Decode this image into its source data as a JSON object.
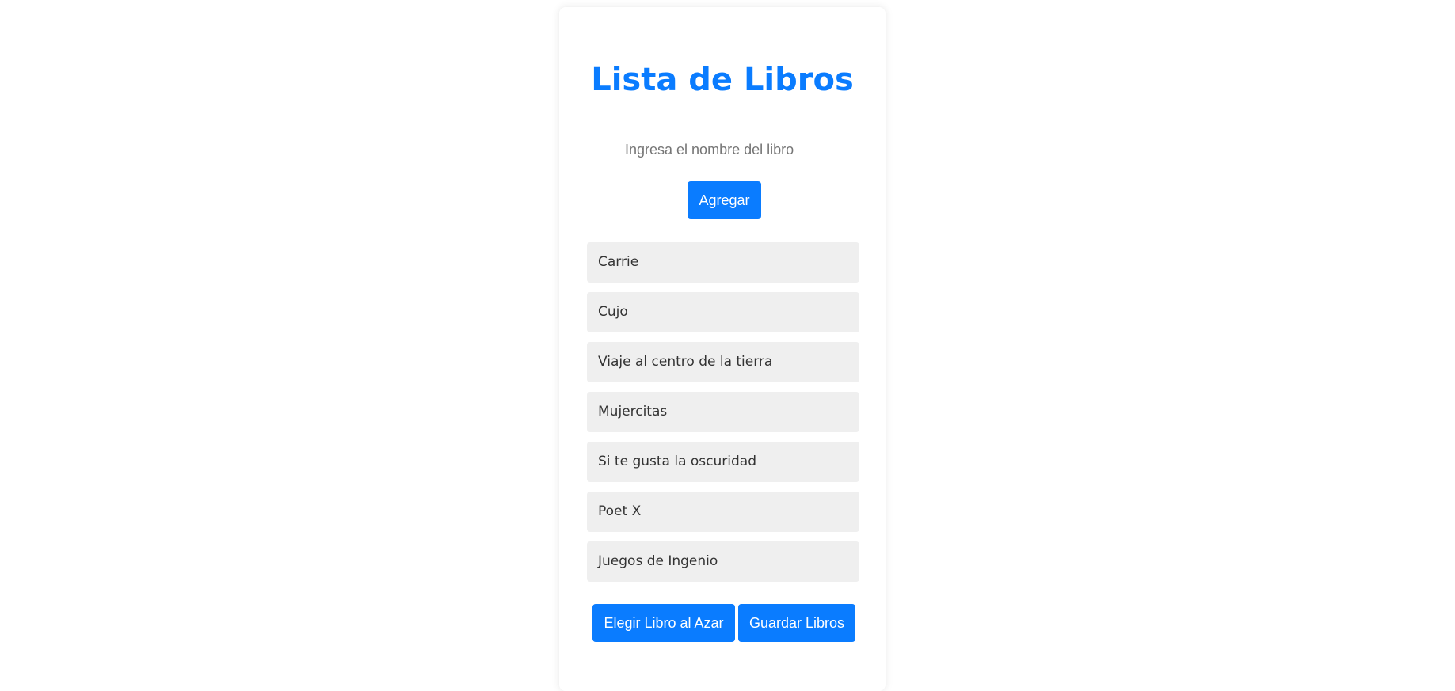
{
  "page": {
    "title": "Lista de Libros"
  },
  "form": {
    "input_placeholder": "Ingresa el nombre del libro",
    "input_value": "",
    "add_button_label": "Agregar"
  },
  "books": [
    {
      "title": "Carrie"
    },
    {
      "title": "Cujo"
    },
    {
      "title": "Viaje al centro de la tierra"
    },
    {
      "title": "Mujercitas"
    },
    {
      "title": "Si te gusta la oscuridad"
    },
    {
      "title": "Poet X"
    },
    {
      "title": "Juegos de Ingenio"
    }
  ],
  "actions": {
    "random_button_label": "Elegir Libro al Azar",
    "save_button_label": "Guardar Libros"
  },
  "colors": {
    "accent": "#0a7cff",
    "item_background": "#efefef",
    "background": "#ffffff"
  }
}
